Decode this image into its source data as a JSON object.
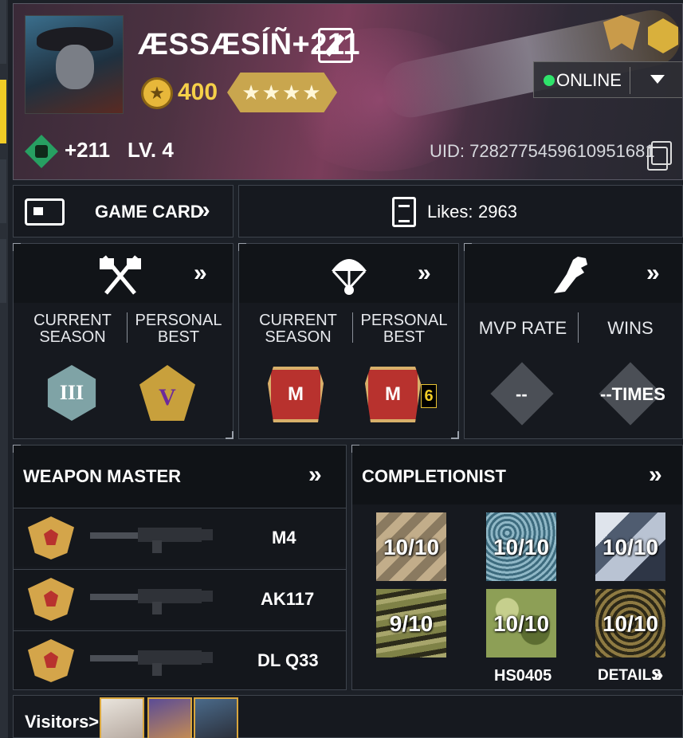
{
  "profile": {
    "name": "ÆSSÆSÍÑ+211",
    "coins": "400",
    "rank_stars": "★★★★",
    "clan_tag": "+211",
    "level": "LV. 4",
    "uid": "UID: 7282775459610951681",
    "status": "ONLINE"
  },
  "game_card": {
    "label": "GAME CARD"
  },
  "likes": {
    "label": "Likes:",
    "count": "2963"
  },
  "mp_stats": {
    "current_label": "CURRENT SEASON",
    "best_label": "PERSONAL BEST"
  },
  "br_stats": {
    "current_label": "CURRENT SEASON",
    "best_label": "PERSONAL BEST",
    "best_count": "6"
  },
  "zombie_stats": {
    "mvp_label": "MVP RATE",
    "wins_label": "WINS",
    "mvp_value": "--",
    "wins_value": "--TIMES"
  },
  "weapon_master": {
    "title": "WEAPON MASTER",
    "weapons": [
      {
        "name": "M4"
      },
      {
        "name": "AK117"
      },
      {
        "name": "DL Q33"
      }
    ]
  },
  "completionist": {
    "title": "COMPLETIONIST",
    "camos": [
      {
        "progress": "10/10"
      },
      {
        "progress": "10/10"
      },
      {
        "progress": "10/10"
      },
      {
        "progress": "9/10"
      },
      {
        "progress": "10/10"
      },
      {
        "progress": "10/10"
      }
    ],
    "footer_left": "HS0405",
    "details_label": "DETAILS"
  },
  "visitors": {
    "label": "Visitors>"
  },
  "icons": {
    "chevron": "»",
    "online_color": "#2fe36b",
    "accent": "#f1cc26"
  }
}
